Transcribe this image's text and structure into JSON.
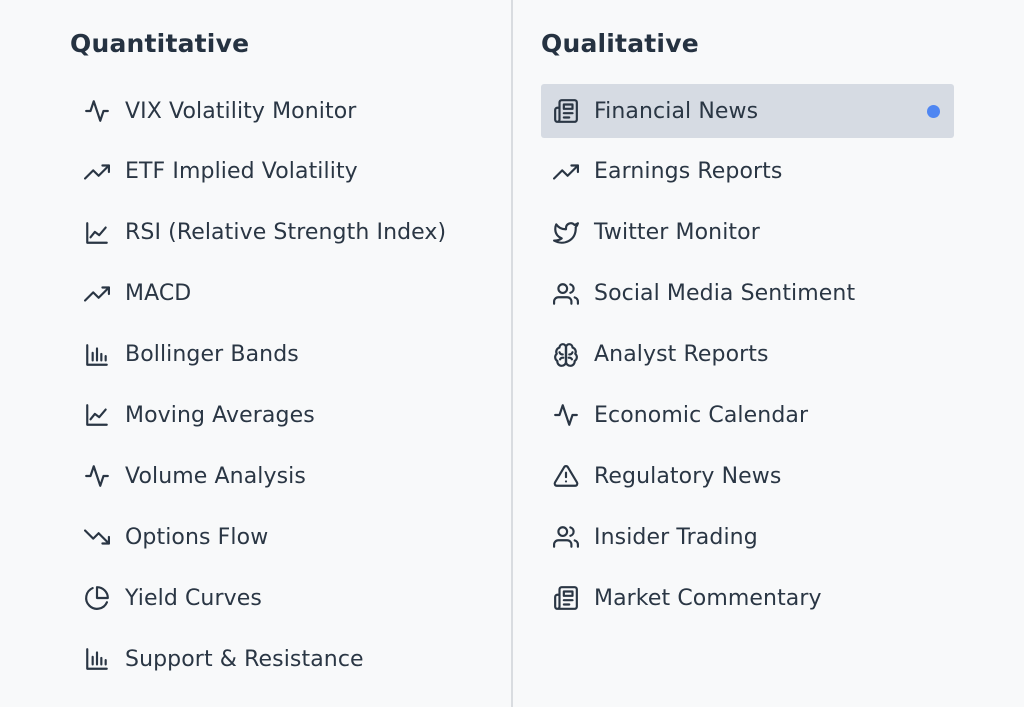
{
  "quantitative": {
    "title": "Quantitative",
    "items": [
      {
        "label": "VIX Volatility Monitor",
        "icon": "activity-icon"
      },
      {
        "label": "ETF Implied Volatility",
        "icon": "trending-up-icon"
      },
      {
        "label": "RSI (Relative Strength Index)",
        "icon": "line-chart-icon"
      },
      {
        "label": "MACD",
        "icon": "trending-up-icon"
      },
      {
        "label": "Bollinger Bands",
        "icon": "bar-chart-icon"
      },
      {
        "label": "Moving Averages",
        "icon": "line-chart-icon"
      },
      {
        "label": "Volume Analysis",
        "icon": "activity-icon"
      },
      {
        "label": "Options Flow",
        "icon": "trending-down-icon"
      },
      {
        "label": "Yield Curves",
        "icon": "pie-chart-icon"
      },
      {
        "label": "Support & Resistance",
        "icon": "bar-chart-icon"
      }
    ]
  },
  "qualitative": {
    "title": "Qualitative",
    "items": [
      {
        "label": "Financial News",
        "icon": "newspaper-icon",
        "active": true
      },
      {
        "label": "Earnings Reports",
        "icon": "trending-up-icon"
      },
      {
        "label": "Twitter Monitor",
        "icon": "twitter-icon"
      },
      {
        "label": "Social Media Sentiment",
        "icon": "users-icon"
      },
      {
        "label": "Analyst Reports",
        "icon": "brain-icon"
      },
      {
        "label": "Economic Calendar",
        "icon": "activity-icon"
      },
      {
        "label": "Regulatory News",
        "icon": "alert-triangle-icon"
      },
      {
        "label": "Insider Trading",
        "icon": "users-icon"
      },
      {
        "label": "Market Commentary",
        "icon": "newspaper-icon"
      }
    ]
  },
  "colors": {
    "background": "#f8f9fa",
    "active_background": "#d6dbe3",
    "active_dot": "#4f86f2",
    "text": "#2a3644",
    "divider": "#d9dce0"
  }
}
